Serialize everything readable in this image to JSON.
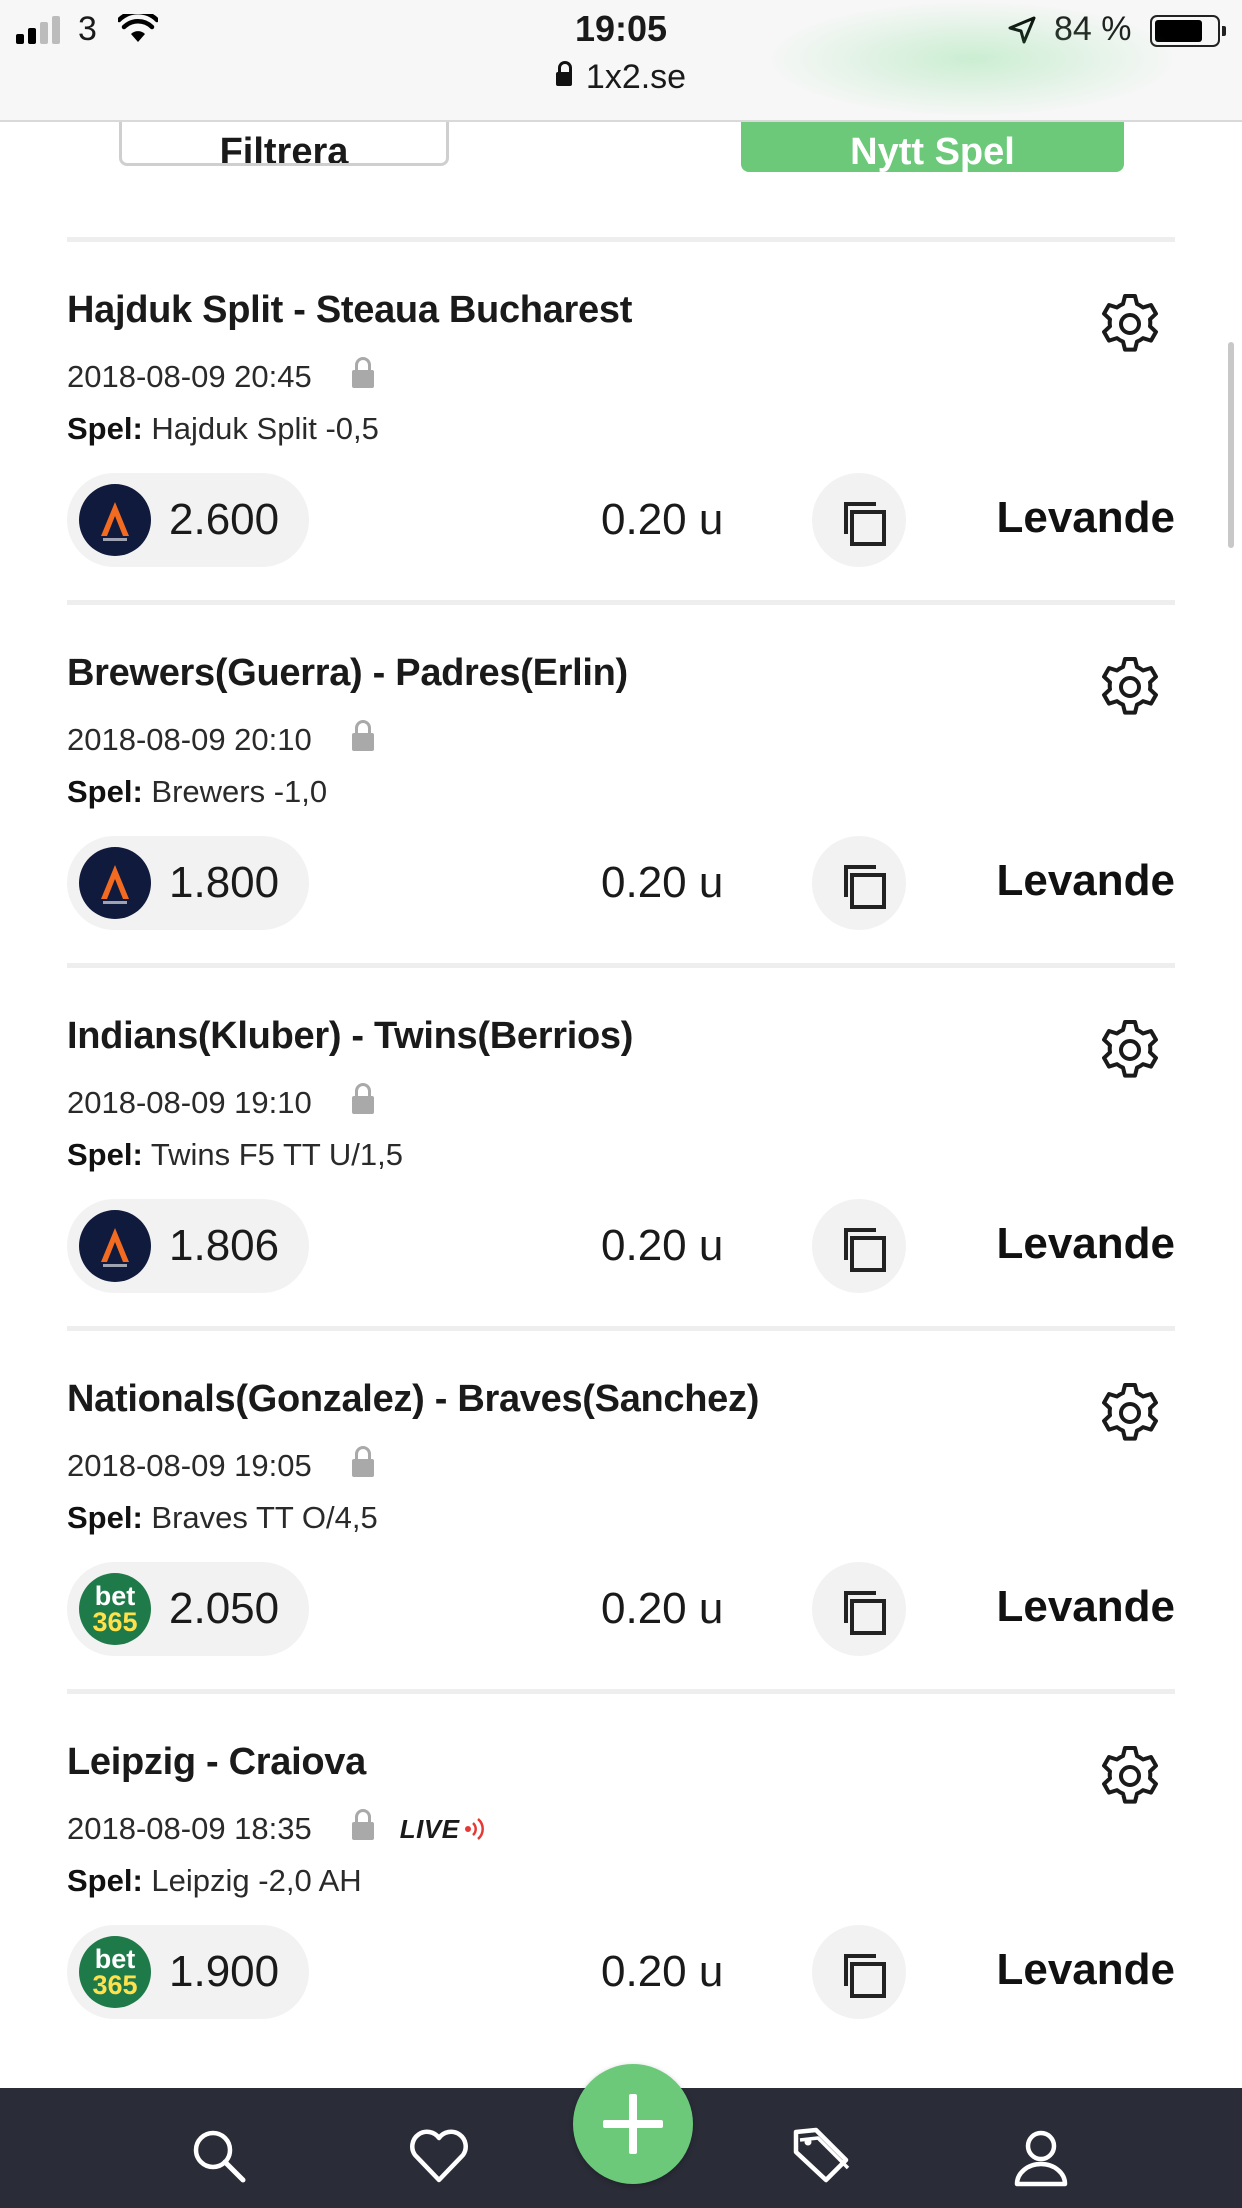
{
  "status_bar": {
    "carrier": "3",
    "time": "19:05",
    "url": "1x2.se",
    "battery_percent": "84 %",
    "battery_level": 0.84
  },
  "toolbar": {
    "filter_label": "Filtrera",
    "new_bet_label": "Nytt Spel"
  },
  "bets": [
    {
      "match": "Hajduk Split - Steaua Bucharest",
      "datetime": "2018-08-09 20:45",
      "live": false,
      "pick_label": "Spel:",
      "pick": "Hajduk Split -0,5",
      "bookmaker": "pinnacle",
      "odds": "2.600",
      "stake": "0.20 u",
      "status": "Levande"
    },
    {
      "match": "Brewers(Guerra) - Padres(Erlin)",
      "datetime": "2018-08-09 20:10",
      "live": false,
      "pick_label": "Spel:",
      "pick": "Brewers -1,0",
      "bookmaker": "pinnacle",
      "odds": "1.800",
      "stake": "0.20 u",
      "status": "Levande"
    },
    {
      "match": "Indians(Kluber) - Twins(Berrios)",
      "datetime": "2018-08-09 19:10",
      "live": false,
      "pick_label": "Spel:",
      "pick": "Twins F5 TT U/1,5",
      "bookmaker": "pinnacle",
      "odds": "1.806",
      "stake": "0.20 u",
      "status": "Levande"
    },
    {
      "match": "Nationals(Gonzalez) - Braves(Sanchez)",
      "datetime": "2018-08-09 19:05",
      "live": false,
      "pick_label": "Spel:",
      "pick": "Braves TT O/4,5",
      "bookmaker": "bet365",
      "odds": "2.050",
      "stake": "0.20 u",
      "status": "Levande"
    },
    {
      "match": "Leipzig - Craiova",
      "datetime": "2018-08-09 18:35",
      "live": true,
      "live_label": "LIVE",
      "pick_label": "Spel:",
      "pick": "Leipzig -2,0 AH",
      "bookmaker": "bet365",
      "odds": "1.900",
      "stake": "0.20 u",
      "status": "Levande"
    }
  ],
  "bookmaker_logos": {
    "bet365_top": "bet",
    "bet365_bottom": "365"
  },
  "tabbar": {
    "items": [
      "search-icon",
      "heart-icon",
      "add-icon",
      "tag-icon",
      "user-icon"
    ]
  },
  "colors": {
    "accent_green": "#6cc97a",
    "tabbar_bg": "#2a2c38",
    "pill_bg": "#f2f2f2",
    "live_red": "#e53935"
  }
}
